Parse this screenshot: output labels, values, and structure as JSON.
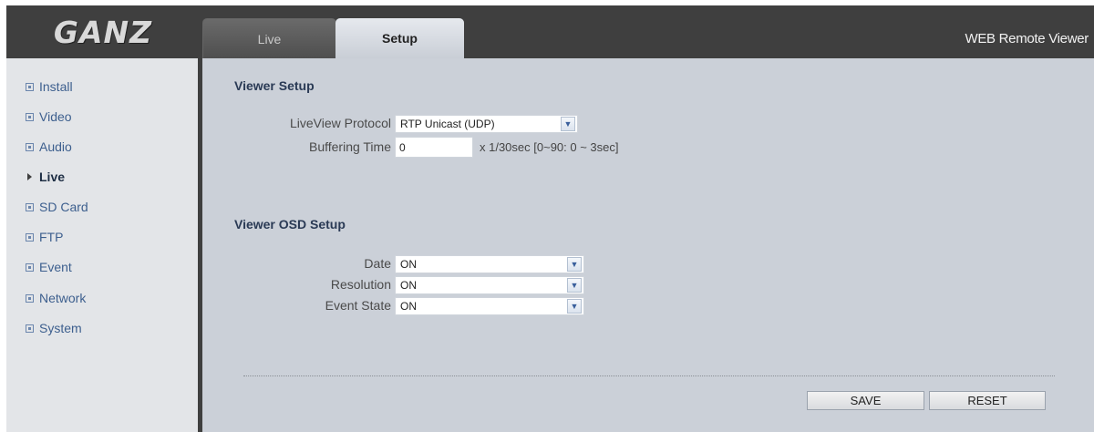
{
  "brand": {
    "logo_text": "GANZ"
  },
  "tabs": [
    {
      "label": "Live"
    },
    {
      "label": "Setup"
    }
  ],
  "app_title": "WEB Remote Viewer",
  "sidebar": {
    "items": [
      {
        "label": "Install"
      },
      {
        "label": "Video"
      },
      {
        "label": "Audio"
      },
      {
        "label": "Live"
      },
      {
        "label": "SD Card"
      },
      {
        "label": "FTP"
      },
      {
        "label": "Event"
      },
      {
        "label": "Network"
      },
      {
        "label": "System"
      }
    ],
    "active": "Live"
  },
  "viewer_setup": {
    "title": "Viewer Setup",
    "protocol_label": "LiveView Protocol",
    "protocol_value": "RTP Unicast (UDP)",
    "buffering_label": "Buffering Time",
    "buffering_value": "0",
    "buffering_hint": "x 1/30sec [0~90: 0 ~ 3sec]"
  },
  "osd_setup": {
    "title": "Viewer OSD Setup",
    "date_label": "Date",
    "date_value": "ON",
    "resolution_label": "Resolution",
    "resolution_value": "ON",
    "event_state_label": "Event State",
    "event_state_value": "ON"
  },
  "actions": {
    "save_label": "SAVE",
    "reset_label": "RESET"
  },
  "colors": {
    "frame": "#3f3f3f",
    "sidebar_bg": "#e3e5e8",
    "panel_bg": "#cbd0d8",
    "link": "#3d5f8e"
  }
}
